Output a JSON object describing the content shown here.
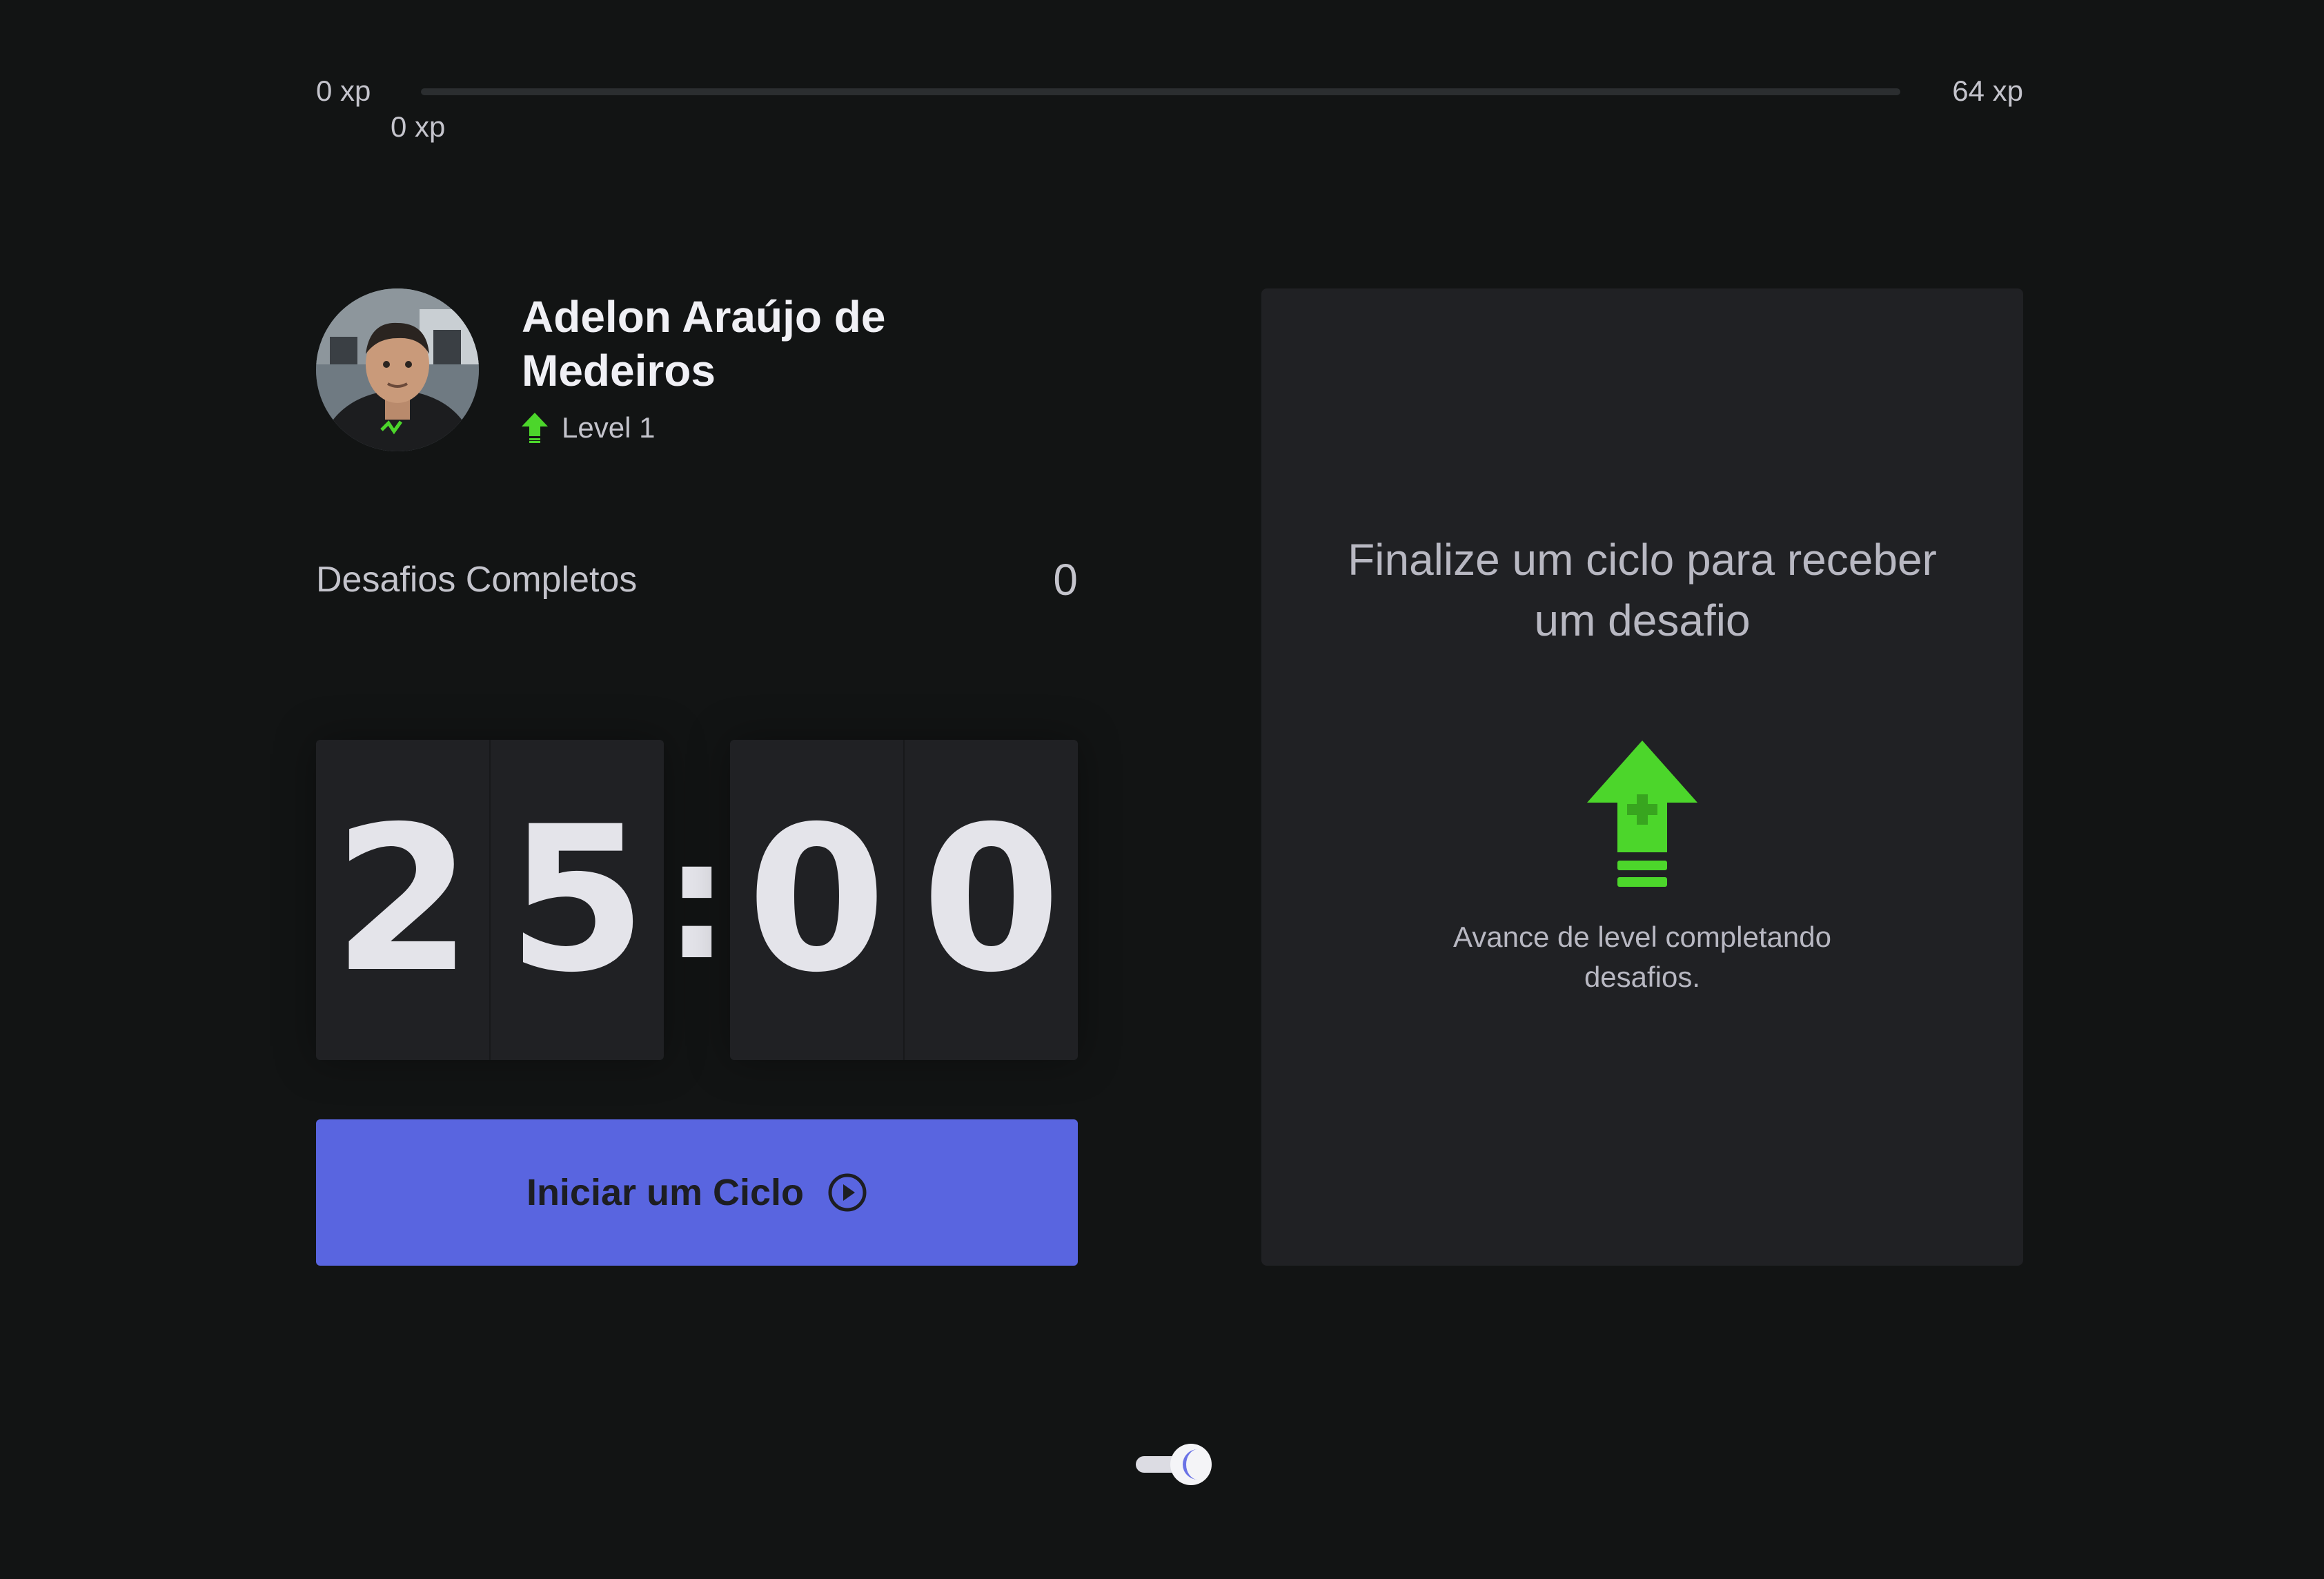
{
  "xp": {
    "min_label": "0 xp",
    "max_label": "64 xp",
    "current_label": "0 xp",
    "progress_fraction": 0
  },
  "profile": {
    "name": "Adelon Araújo de Medeiros",
    "level_label": "Level 1",
    "level_icon": "level-up-arrow-icon"
  },
  "completed": {
    "label": "Desafios Completos",
    "count": "0"
  },
  "countdown": {
    "minute_left": "2",
    "minute_right": "5",
    "separator": ":",
    "second_left": "0",
    "second_right": "0"
  },
  "start_button": {
    "label": "Iniciar um Ciclo",
    "icon": "play-circle-icon",
    "color": "#5965e0"
  },
  "challenge": {
    "title": "Finalize um ciclo para receber um desafio",
    "hint": "Avance de level completando desafios.",
    "icon": "level-up-icon"
  },
  "theme_toggle": {
    "icon": "moon-icon",
    "mode": "dark"
  },
  "colors": {
    "background": "#121414",
    "card": "#202124",
    "accent_green": "#4cd62b",
    "accent_blue": "#5965e0"
  }
}
